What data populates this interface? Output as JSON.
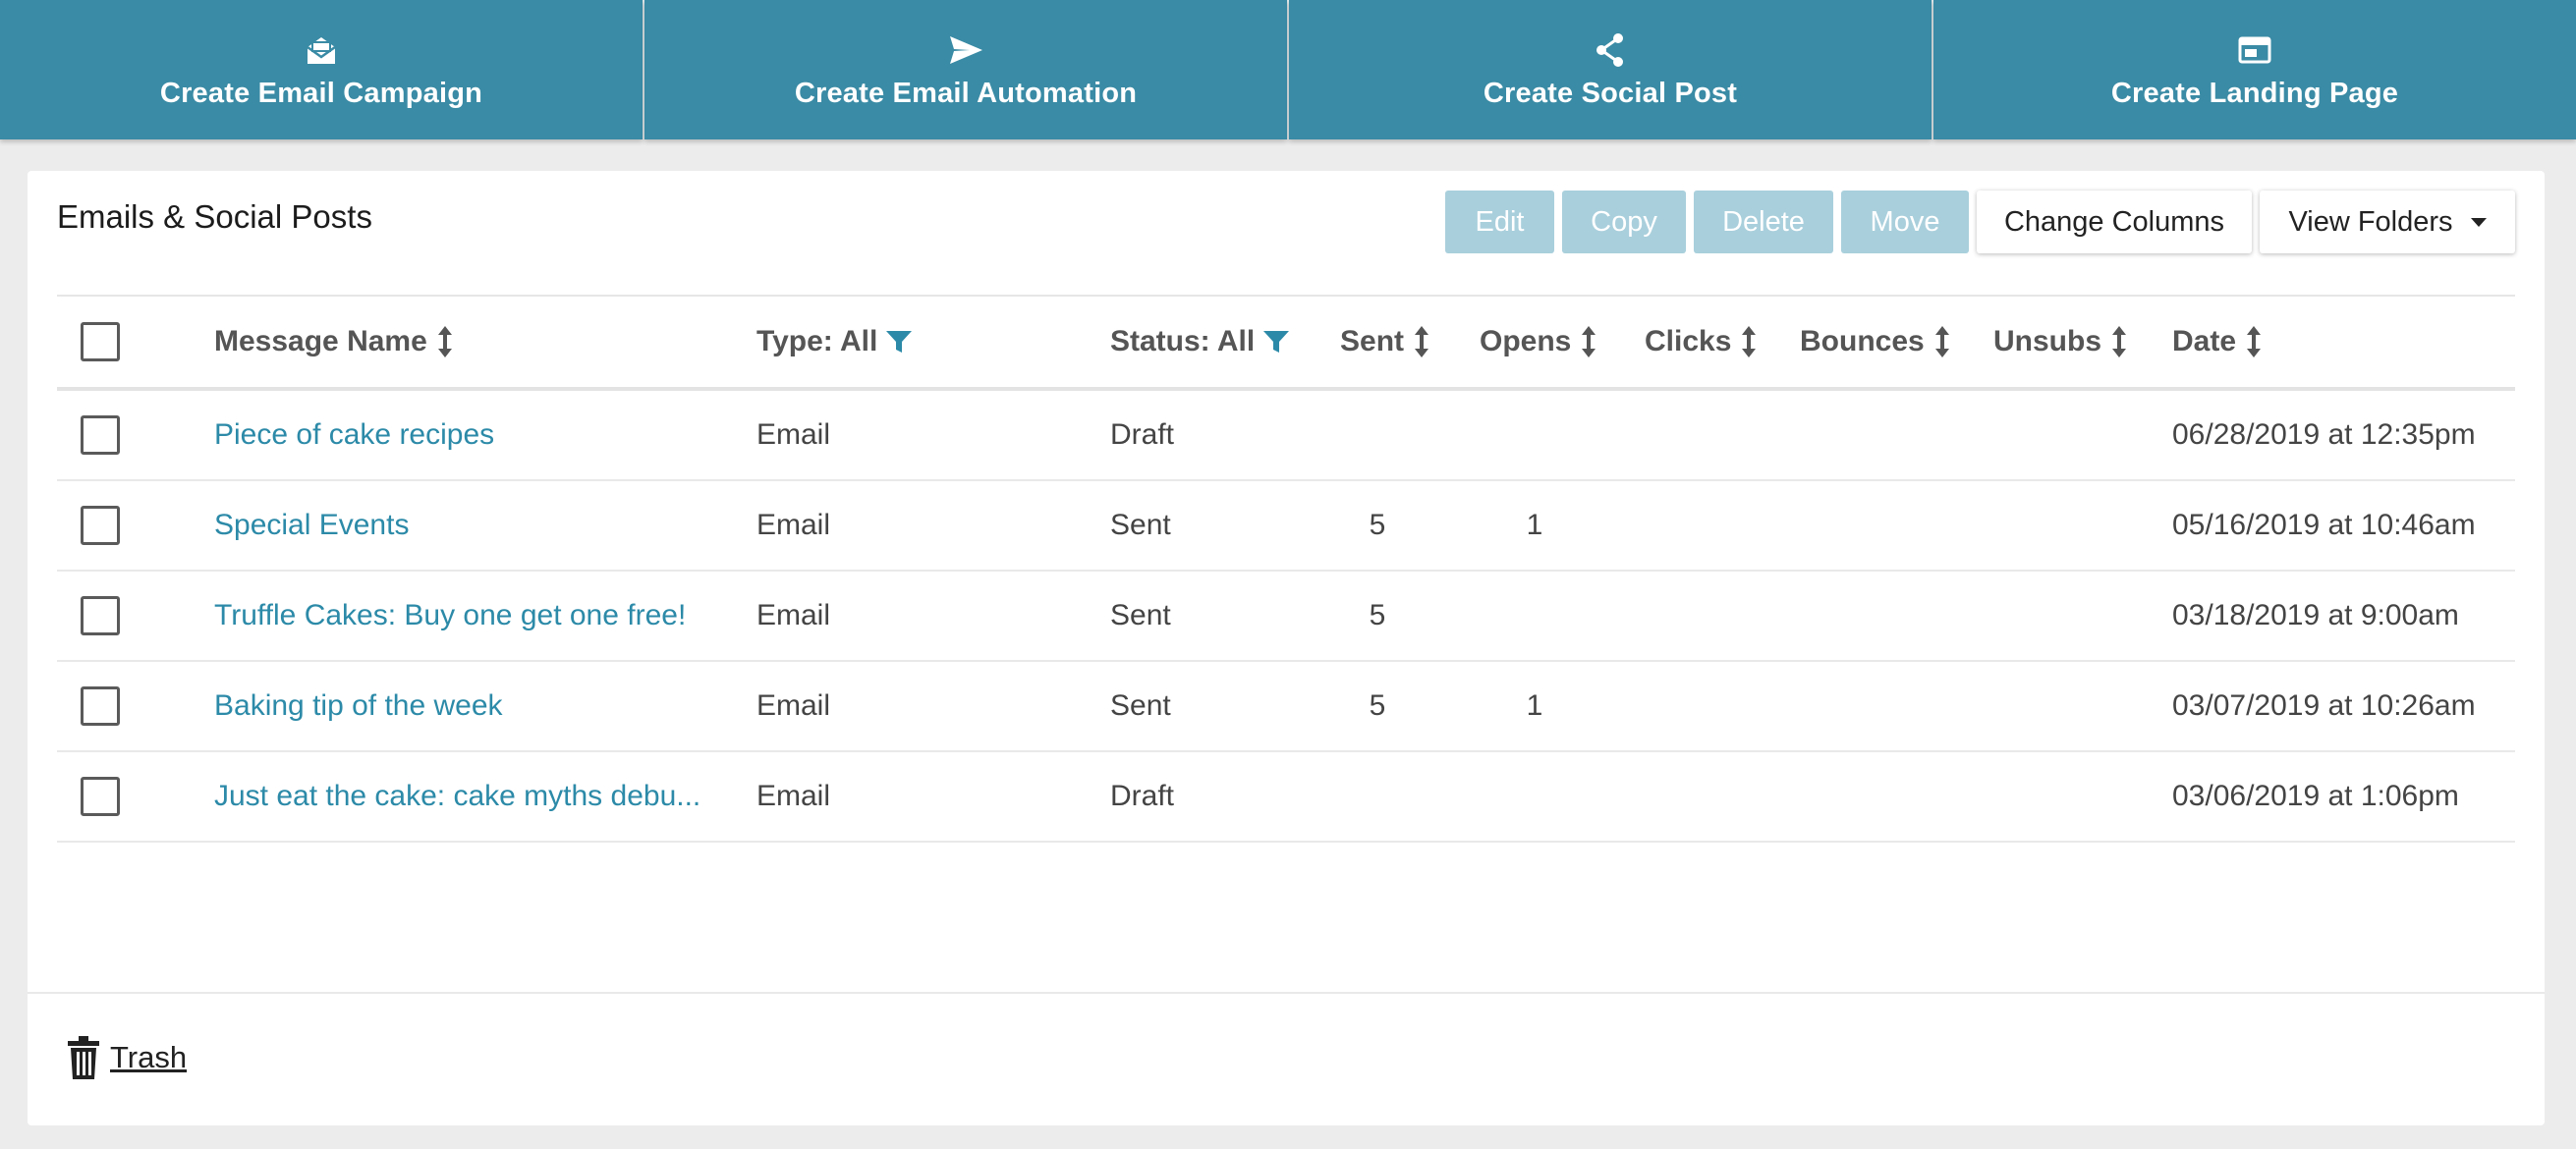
{
  "top_actions": [
    {
      "label": "Create Email Campaign",
      "icon": "envelope-open-icon"
    },
    {
      "label": "Create Email Automation",
      "icon": "paper-plane-icon"
    },
    {
      "label": "Create Social Post",
      "icon": "share-icon"
    },
    {
      "label": "Create Landing Page",
      "icon": "browser-window-icon"
    }
  ],
  "card": {
    "title": "Emails & Social Posts"
  },
  "toolbar": {
    "edit": "Edit",
    "copy": "Copy",
    "delete": "Delete",
    "move": "Move",
    "change_columns": "Change Columns",
    "view_folders": "View Folders"
  },
  "table": {
    "columns": {
      "name": "Message Name",
      "type": "Type: All",
      "status": "Status: All",
      "sent": "Sent",
      "opens": "Opens",
      "clicks": "Clicks",
      "bounces": "Bounces",
      "unsubs": "Unsubs",
      "date": "Date"
    },
    "rows": [
      {
        "name": "Piece of cake recipes",
        "type": "Email",
        "status": "Draft",
        "sent": "",
        "opens": "",
        "clicks": "",
        "bounces": "",
        "unsubs": "",
        "date": "06/28/2019 at 12:35pm"
      },
      {
        "name": "Special Events",
        "type": "Email",
        "status": "Sent",
        "sent": "5",
        "opens": "1",
        "clicks": "",
        "bounces": "",
        "unsubs": "",
        "date": "05/16/2019 at 10:46am"
      },
      {
        "name": "Truffle Cakes: Buy one get one free!",
        "type": "Email",
        "status": "Sent",
        "sent": "5",
        "opens": "",
        "clicks": "",
        "bounces": "",
        "unsubs": "",
        "date": "03/18/2019 at 9:00am"
      },
      {
        "name": "Baking tip of the week",
        "type": "Email",
        "status": "Sent",
        "sent": "5",
        "opens": "1",
        "clicks": "",
        "bounces": "",
        "unsubs": "",
        "date": "03/07/2019 at 10:26am"
      },
      {
        "name": "Just eat the cake: cake myths debu...",
        "type": "Email",
        "status": "Draft",
        "sent": "",
        "opens": "",
        "clicks": "",
        "bounces": "",
        "unsubs": "",
        "date": "03/06/2019 at 1:06pm"
      }
    ]
  },
  "footer": {
    "trash_label": "Trash"
  },
  "colors": {
    "tile_bg": "#3a8ba5",
    "link": "#2c8aa8",
    "disabled_button": "#a9cfdc",
    "page_bg": "#ececec"
  }
}
